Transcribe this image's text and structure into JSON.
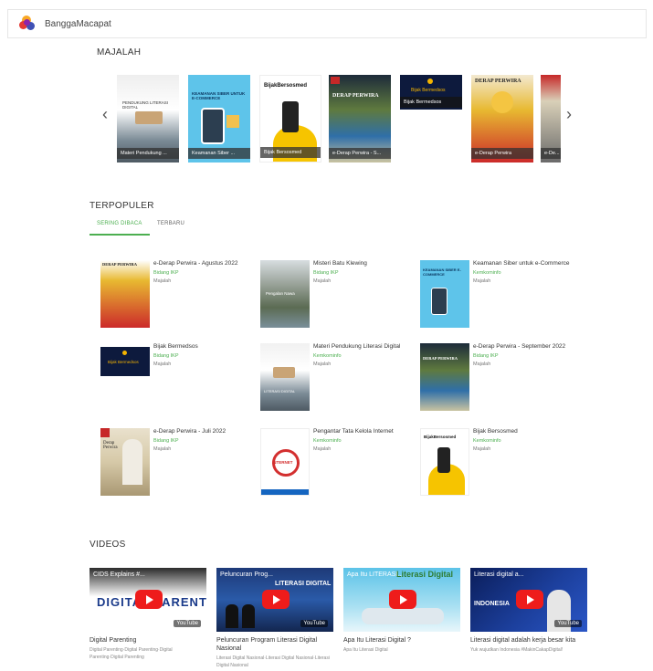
{
  "header": {
    "brand": "BanggaMacapat"
  },
  "sections": {
    "majalah": "MAJALAH",
    "terpopuler": "TERPOPULER",
    "videos": "VIDEOS"
  },
  "tabs": [
    {
      "label": "SERING DIBACA",
      "active": true
    },
    {
      "label": "TERBARU",
      "active": false
    }
  ],
  "carousel": {
    "prev": "‹",
    "next": "›",
    "items": [
      {
        "caption": "Materi Pendukung ...",
        "cover_text": "PENDUKUNG LITERASI DIGITAL"
      },
      {
        "caption": "Keamanan Siber ...",
        "cover_text": "KEAMANAN SIBER UNTUK E-COMMERCE"
      },
      {
        "caption": "Bijak Bersosmed",
        "cover_text": "BijakBersosmed"
      },
      {
        "caption": "e-Derap Perwira - S...",
        "cover_text": "DERAP PERWIRA"
      },
      {
        "caption": "Bijak Bermedsos",
        "cover_text": "Bijak Bermedsos"
      },
      {
        "caption": "e-Derap Perwira",
        "cover_text": "DERAP PERWIRA"
      },
      {
        "caption": "e-De...",
        "cover_text": ""
      }
    ]
  },
  "popular": [
    {
      "title": "e-Derap Perwira - Agustus 2022",
      "source": "Bidang IKP",
      "category": "Majalah",
      "cover_text": "DERAP PERWIRA"
    },
    {
      "title": "Misteri Batu Klewing",
      "source": "Bidang IKP",
      "category": "Majalah",
      "cover_text": "Pengalan Nawa"
    },
    {
      "title": "Keamanan Siber untuk e-Commerce",
      "source": "Kemkominfo",
      "category": "Majalah",
      "cover_text": "KEAMANAN SIBER E-COMMERCE"
    },
    {
      "title": "Bijak Bermedsos",
      "source": "Bidang IKP",
      "category": "Majalah",
      "cover_text": "Bijak Bermedsos"
    },
    {
      "title": "Materi Pendukung Literasi Digital",
      "source": "Kemkominfo",
      "category": "Majalah",
      "cover_text": "LITERASI DIGITAL"
    },
    {
      "title": "e-Derap Perwira - September 2022",
      "source": "Bidang IKP",
      "category": "Majalah",
      "cover_text": "DERAP PERWIRA"
    },
    {
      "title": "e-Derap Perwira - Juli 2022",
      "source": "Bidang IKP",
      "category": "Majalah",
      "cover_text": "Derap Perwira"
    },
    {
      "title": "Pengantar Tata Kelola Internet",
      "source": "Kemkominfo",
      "category": "Majalah",
      "cover_text": "INTERNET"
    },
    {
      "title": "Bijak Bersosmed",
      "source": "Kemkominfo",
      "category": "Majalah",
      "cover_text": "BijakBersosmed"
    }
  ],
  "videos": [
    {
      "overlay": "CIDS Explains #...",
      "big": "DIGITAL PARENTING",
      "title": "Digital Parenting",
      "desc": "Digital Parenting·Digital Parenting·Digital Parenting·Digital Parenting",
      "yt": "YouTube"
    },
    {
      "overlay": "Peluncuran Prog...",
      "big": "LITERASI DIGITAL",
      "title": "Peluncuran Program Literasi Digital Nasional",
      "desc": "Literasi Digital Nasional·Literasi Digital Nasional·Literasi Digital Nasional",
      "yt": "YouTube"
    },
    {
      "overlay": "Apa Itu LITERASI...",
      "big": "Literasi Digital",
      "title": "Apa Itu Literasi Digital ?",
      "desc": "Apa Itu Literasi Digital",
      "yt": ""
    },
    {
      "overlay": "Literasi digital a...",
      "big": "INDONESIA",
      "title": "Literasi digital adalah kerja besar kita",
      "desc": "Yuk wujudkan Indonesia #MakinCakapDigital!",
      "yt": "YouTube"
    }
  ]
}
